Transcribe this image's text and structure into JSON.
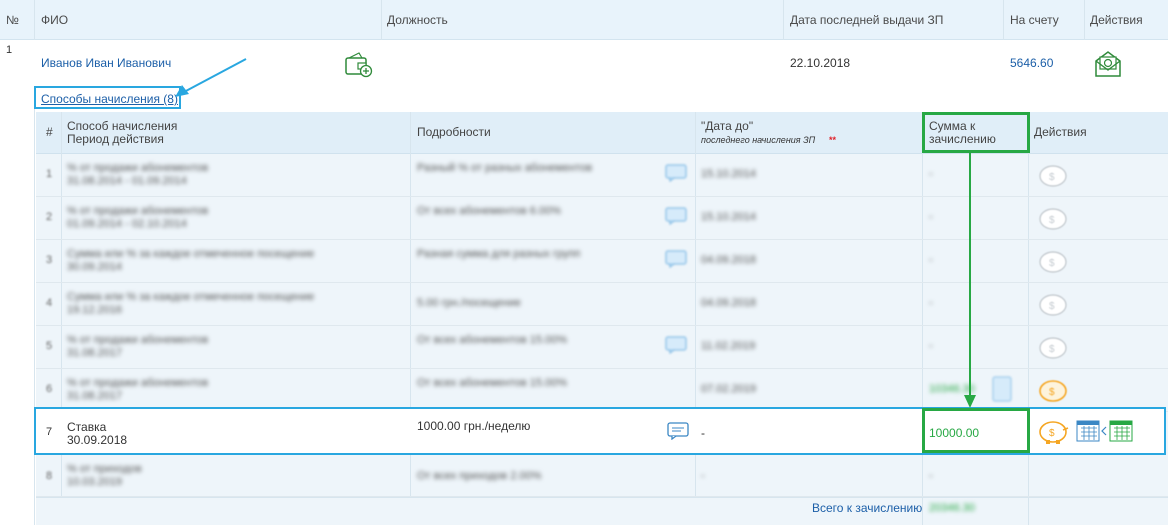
{
  "header": {
    "col_no": "№",
    "col_fio": "ФИО",
    "col_position": "Должность",
    "col_last_pay": "Дата последней выдачи ЗП",
    "col_balance": "На счету",
    "col_actions": "Действия"
  },
  "employee": {
    "no": "1",
    "name": "Иванов Иван Иванович",
    "position": "",
    "last_pay_date": "22.10.2018",
    "balance": "5646.60",
    "accruals_link": "Способы начисления (8)"
  },
  "accruals_table": {
    "header": {
      "col_num": "#",
      "col_method_line1": "Способ начисления",
      "col_method_line2": "Период действия",
      "col_details": "Подробности",
      "col_date_to": "\"Дата до\"",
      "col_date_to_sub": "последнего начисления ЗП",
      "col_date_to_mark": "**",
      "col_amount_line1": "Сумма к",
      "col_amount_line2": "зачислению",
      "col_actions": "Действия"
    },
    "rows": [
      {
        "num": "1",
        "method": "% от продажи абонементов",
        "period": "31.08.2014 - 01.09.2014",
        "details": "Разный % от разных абонементов",
        "date_to": "15.10.2014",
        "amount": "-"
      },
      {
        "num": "2",
        "method": "% от продажи абонементов",
        "period": "01.09.2014 - 02.10.2014",
        "details": "От всех абонементов 6.00%",
        "date_to": "15.10.2014",
        "amount": "-"
      },
      {
        "num": "3",
        "method": "Сумма или % за каждое отмеченное посещение",
        "period": "30.09.2014",
        "details": "Разная сумма для разных групп",
        "date_to": "04.09.2018",
        "amount": "-"
      },
      {
        "num": "4",
        "method": "Сумма или % за каждое отмеченное посещение",
        "period": "19.12.2016",
        "details": "5.00 грн./посещение",
        "date_to": "04.09.2018",
        "amount": "-"
      },
      {
        "num": "5",
        "method": "% от продажи абонементов",
        "period": "31.08.2017",
        "details": "От всех абонементов 15.00%",
        "date_to": "11.02.2019",
        "amount": "-"
      },
      {
        "num": "6",
        "method": "% от продажи абонементов",
        "period": "31.08.2017",
        "details": "От всех абонементов 15.00%",
        "date_to": "07.02.2019",
        "amount": "10346.30"
      },
      {
        "num": "7",
        "method": "Ставка",
        "period": "30.09.2018",
        "details": "1000.00 грн./неделю",
        "date_to": "-",
        "amount": "10000.00"
      },
      {
        "num": "8",
        "method": "% от приходов",
        "period": "10.03.2019",
        "details": "От всех приходов 2.00%",
        "date_to": "-",
        "amount": "-"
      }
    ],
    "total_label": "Всего к зачислению",
    "total_value": "20346.30"
  },
  "colors": {
    "link": "#1c5fa8",
    "highlight_blue": "#29a7e0",
    "highlight_green": "#27a844",
    "header_bg": "#e8f3fb",
    "piggy_orange": "#f5a623"
  },
  "icons": [
    "wallet-add-icon",
    "envelope-money-icon",
    "chat-icon",
    "piggy-bank-icon",
    "calendar-icon",
    "arrow-icon"
  ]
}
